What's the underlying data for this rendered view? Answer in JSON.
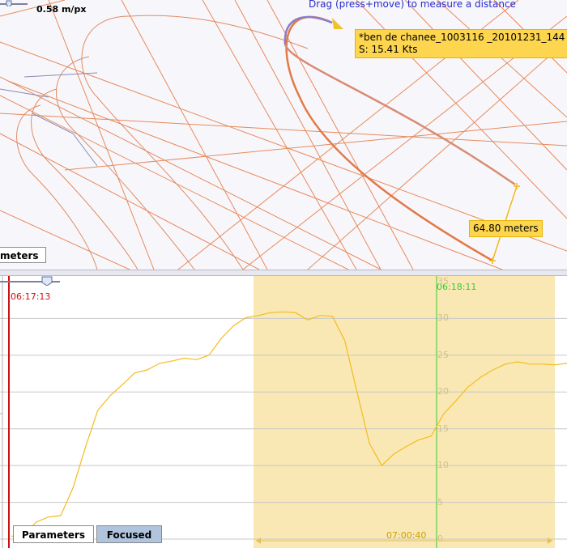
{
  "map": {
    "scale": "0.58 m/px",
    "hint": "Drag (press+move) to measure a distance",
    "boat_tooltip": {
      "name": "*ben de chanee_1003116 _20101231_144",
      "speed": "S: 15.41 Kts"
    },
    "distance": "64.80 meters",
    "parameters_button": "meters"
  },
  "chart": {
    "left_time": "06:17:13",
    "cursor_time": "06:18:11",
    "range_label": "07:00:40"
  },
  "chart_data": {
    "type": "line",
    "y_ticks": [
      "35",
      "30",
      "25",
      "20",
      "15",
      "10",
      "5",
      "0"
    ],
    "ylim": [
      0,
      35
    ],
    "series": [
      {
        "values": [
          0.4,
          0.4,
          2.3,
          3.0,
          3.2,
          7.0,
          12.5,
          17.5,
          19.5,
          21.0,
          22.6,
          23.0,
          23.9,
          24.2,
          24.6,
          24.4,
          25.0,
          27.3,
          29.0,
          30.1,
          30.4,
          30.8,
          30.9,
          30.8,
          29.8,
          30.4,
          30.3,
          27.0,
          20.0,
          13.0,
          10.0,
          11.6,
          12.6,
          13.5,
          14.0,
          17.0,
          18.8,
          20.7,
          22.0,
          23.0,
          23.8,
          24.1,
          23.8,
          23.8,
          23.7,
          23.9
        ]
      }
    ],
    "highlight_color": "#f9e8b4",
    "line_color": "#f5bc1c"
  },
  "tabs": {
    "parameters": "Parameters",
    "focused": "Focused"
  },
  "colors": {
    "track": "#e07040",
    "track_highlight": "#e88a5c",
    "cursor": "#38c838",
    "left_marker": "#d01010"
  }
}
